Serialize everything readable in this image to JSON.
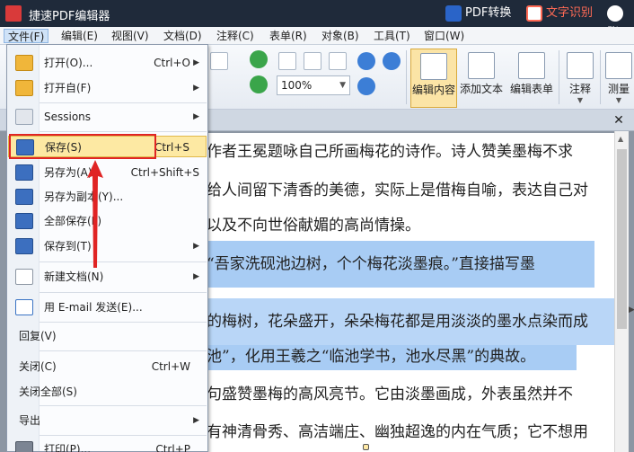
{
  "titlebar": {
    "title": "捷速PDF编辑器",
    "pdf_convert": "PDF转换",
    "ocr": "文字识别",
    "more": "账"
  },
  "menubar": {
    "items": [
      {
        "label": "文件(F)"
      },
      {
        "label": "编辑(E)"
      },
      {
        "label": "视图(V)"
      },
      {
        "label": "文档(D)"
      },
      {
        "label": "注释(C)"
      },
      {
        "label": "表单(R)"
      },
      {
        "label": "对象(B)"
      },
      {
        "label": "工具(T)"
      },
      {
        "label": "窗口(W)"
      }
    ]
  },
  "toolbar": {
    "zoom": "100%",
    "buttons": [
      {
        "label": "编辑内容"
      },
      {
        "label": "添加文本"
      },
      {
        "label": "编辑表单"
      },
      {
        "label": "注释"
      },
      {
        "label": "测量"
      }
    ]
  },
  "file_menu": {
    "items": [
      {
        "label": "打开(O)...",
        "shortcut": "Ctrl+O",
        "icon": "folder-icon",
        "submenu": true
      },
      {
        "label": "打开自(F)",
        "shortcut": "",
        "icon": "folder-icon",
        "submenu": true
      },
      {
        "label": "Sessions",
        "shortcut": "",
        "icon": "sessions-icon",
        "submenu": true
      },
      {
        "label": "保存(S)",
        "shortcut": "Ctrl+S",
        "icon": "save-icon",
        "submenu": false
      },
      {
        "label": "另存为(A)...",
        "shortcut": "Ctrl+Shift+S",
        "icon": "save-as-icon",
        "submenu": false
      },
      {
        "label": "另存为副本(Y)...",
        "shortcut": "",
        "icon": "save-copy-icon",
        "submenu": false
      },
      {
        "label": "全部保存(L)",
        "shortcut": "",
        "icon": "save-all-icon",
        "submenu": false
      },
      {
        "label": "保存到(T)",
        "shortcut": "",
        "icon": "save-to-icon",
        "submenu": true
      },
      {
        "label": "新建文档(N)",
        "shortcut": "",
        "icon": "new-document-icon",
        "submenu": true
      },
      {
        "label": "用 E-mail 发送(E)...",
        "shortcut": "",
        "icon": "email-icon",
        "submenu": false
      },
      {
        "label": "回复(V)",
        "shortcut": "",
        "icon": "",
        "submenu": false
      },
      {
        "label": "关闭(C)",
        "shortcut": "Ctrl+W",
        "icon": "",
        "submenu": false
      },
      {
        "label": "关闭全部(S)",
        "shortcut": "",
        "icon": "",
        "submenu": false
      },
      {
        "label": "导出",
        "shortcut": "",
        "icon": "",
        "submenu": true
      },
      {
        "label": "打印(P)...",
        "shortcut": "Ctrl+P",
        "icon": "print-icon",
        "submenu": false
      }
    ]
  },
  "document": {
    "lines": [
      "作者王冕题咏自己所画梅花的诗作。诗人赞美墨梅不求",
      "给人间留下清香的美德，实际上是借梅自喻，表达自己对",
      "以及不向世俗献媚的高尚情操。",
      "“吾家洗砚池边树，个个梅花淡墨痕。”直接描写墨",
      "",
      "的梅树，花朵盛开，朵朵梅花都是用淡淡的墨水点染而成",
      "池”，化用王羲之“临池学书，池水尽黑”的典故。",
      "句盛赞墨梅的高风亮节。它由淡墨画成，外表虽然并不",
      "有神清骨秀、高洁端庄、幽独超逸的内在气质；它不想用"
    ]
  }
}
